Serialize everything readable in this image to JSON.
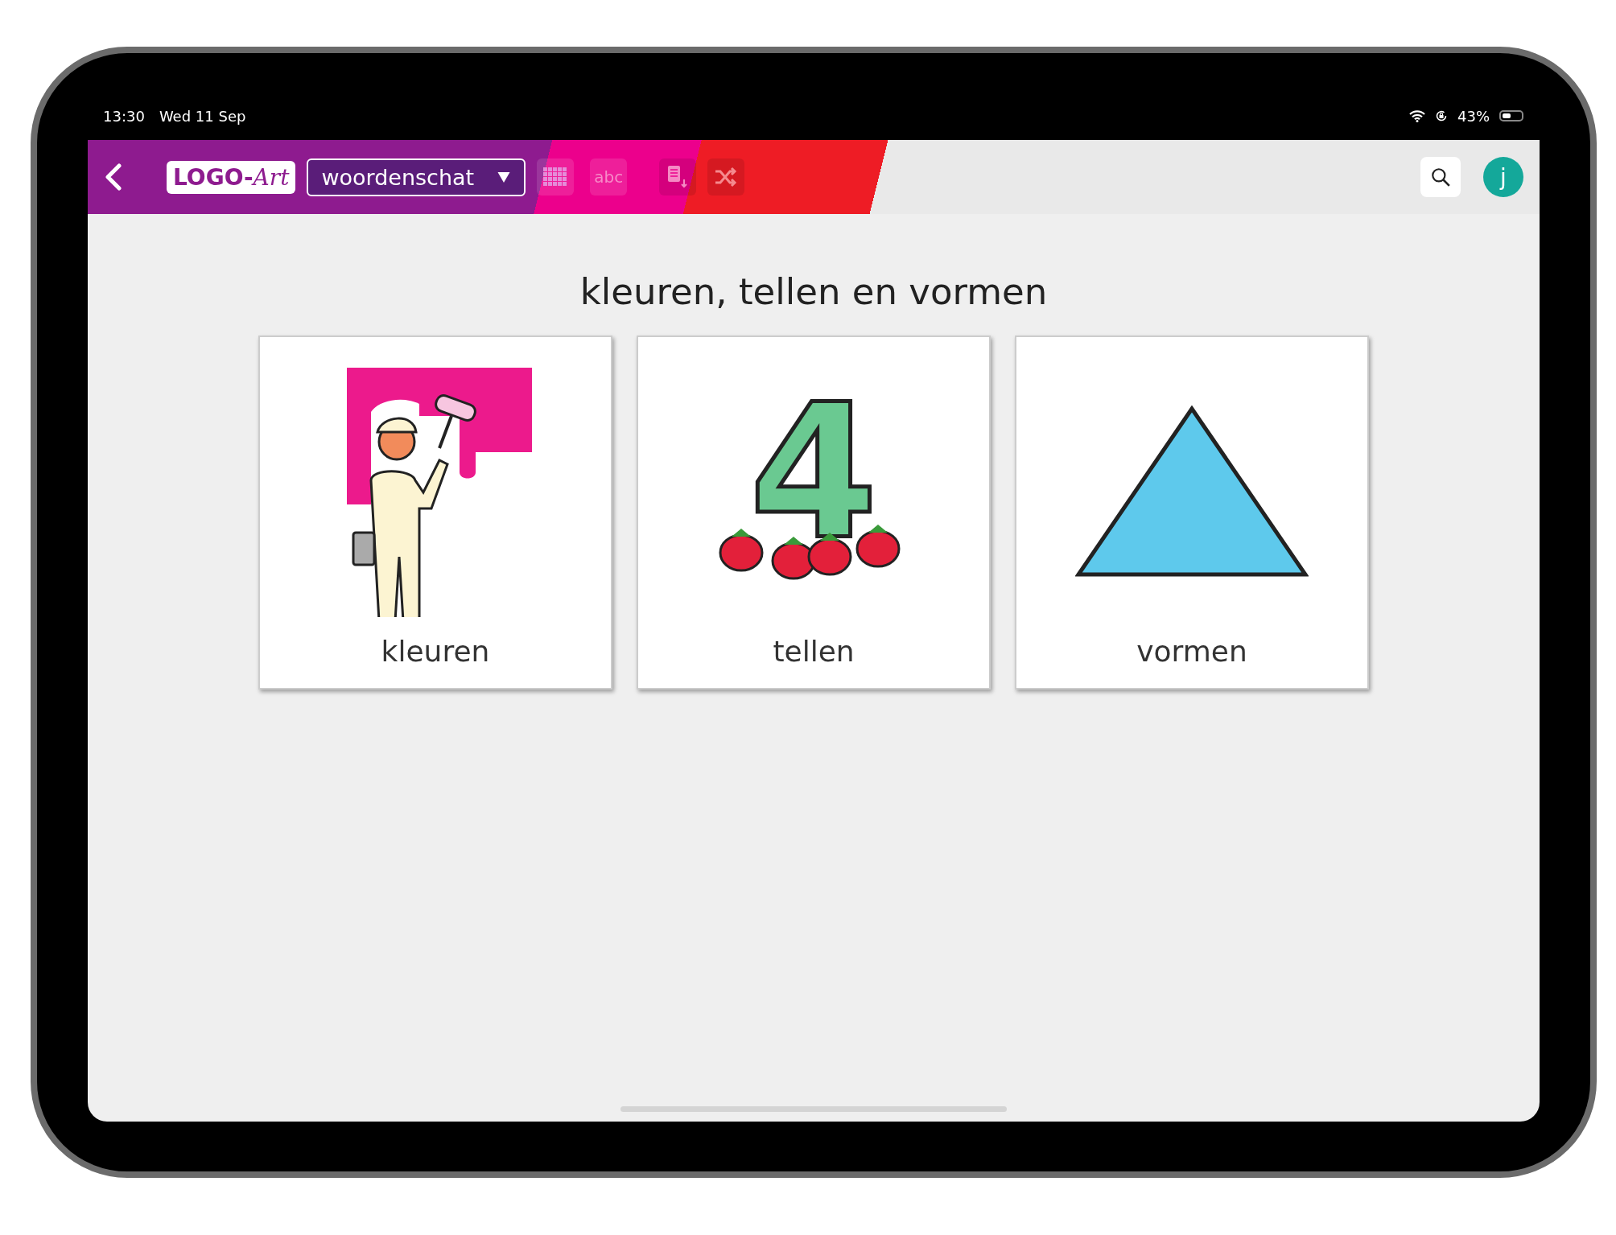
{
  "status_bar": {
    "time": "13:30",
    "date": "Wed 11 Sep",
    "battery": {
      "label": "43%"
    }
  },
  "toolbar": {
    "logo": {
      "main": "LOGO-",
      "accent": "Art"
    },
    "category": {
      "value": "woordenschat"
    },
    "tools": [
      {
        "kind": "grid"
      },
      {
        "kind": "text",
        "label": "abc"
      },
      {
        "kind": "list"
      },
      {
        "kind": "shuffle"
      }
    ],
    "avatar": "j"
  },
  "title": "kleuren, tellen en vormen",
  "cards": [
    {
      "kind": "painter",
      "label": "kleuren"
    },
    {
      "kind": "number",
      "label": "tellen",
      "number": "4"
    },
    {
      "kind": "triangle",
      "label": "vormen"
    }
  ]
}
